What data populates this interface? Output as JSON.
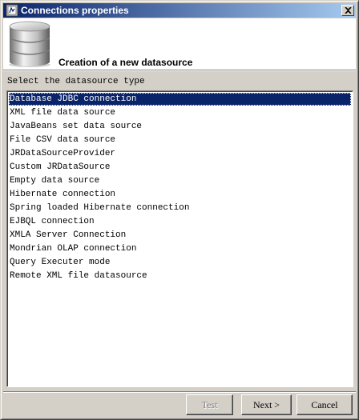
{
  "window": {
    "title": "Connections properties"
  },
  "header": {
    "title": "Creation of a new datasource"
  },
  "label": "Select the datasource type",
  "list": {
    "items": [
      "Database JDBC connection",
      "XML file data source",
      "JavaBeans set data source",
      "File CSV data source",
      "JRDataSourceProvider",
      "Custom JRDataSource",
      "Empty data source",
      "Hibernate connection",
      "Spring loaded Hibernate connection",
      "EJBQL connection",
      "XMLA Server Connection",
      "Mondrian OLAP connection",
      "Query Executer mode",
      "Remote XML file datasource"
    ],
    "selected_index": 0
  },
  "buttons": {
    "test": "Test",
    "next": "Next >",
    "cancel": "Cancel"
  },
  "colors": {
    "title_bar_start": "#0a246a",
    "title_bar_end": "#a6caf0",
    "selection": "#0a246a"
  },
  "icons": {
    "title": "app-icon",
    "header": "database-icon",
    "close": "close-icon"
  }
}
